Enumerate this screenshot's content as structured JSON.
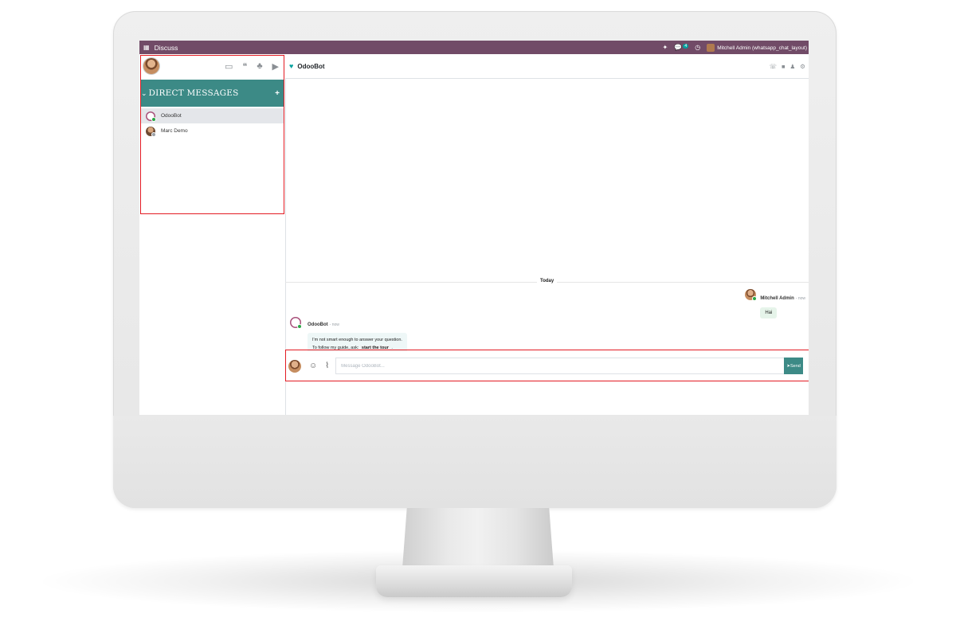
{
  "topbar": {
    "app_name": "Discuss",
    "apps_icon": "grid-icon",
    "message_count": "4",
    "user_name": "Mitchell Admin (whatsapp_chat_layout)",
    "brand_color": "#714b67"
  },
  "sidebar": {
    "icons": [
      "inbox-icon",
      "chat-icon",
      "group-icon",
      "video-icon"
    ],
    "section_title": "DIRECT MESSAGES",
    "section_color": "#3c8a86",
    "items": [
      {
        "label": "OdooBot",
        "status": "online",
        "active": true
      },
      {
        "label": "Marc Demo",
        "status": "offline",
        "active": false
      }
    ]
  },
  "thread": {
    "name": "OdooBot",
    "header_icons": [
      "phone-icon",
      "camera-icon",
      "add-user-icon",
      "gear-icon"
    ]
  },
  "messages": {
    "date_separator": "Today",
    "outgoing": {
      "author": "Mitchell Admin",
      "time": "- now",
      "text": "Hai"
    },
    "incoming": {
      "author": "OdooBot",
      "time": "- now",
      "line1": "I'm not smart enough to answer your question.",
      "line2_prefix": "To follow my guide, ask:",
      "command": "start the tour",
      "line2_suffix": "."
    }
  },
  "composer": {
    "placeholder": "Message OdooBot...",
    "send_label": "Send"
  }
}
